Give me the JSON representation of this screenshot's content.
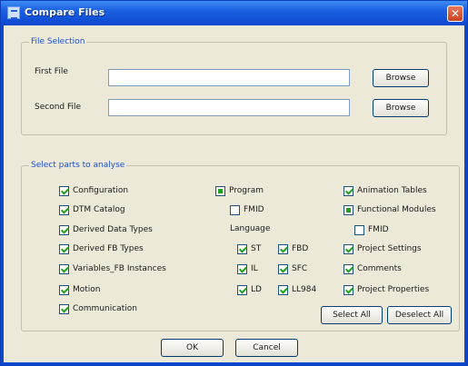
{
  "window": {
    "title": "Compare Files",
    "close_glyph": "✕"
  },
  "file_selection": {
    "legend": "File Selection",
    "first_label": "First File",
    "first_value": "",
    "second_label": "Second File",
    "second_value": "",
    "browse_label": "Browse"
  },
  "parts": {
    "legend": "Select parts to analyse",
    "col1": [
      {
        "label": "Configuration",
        "state": "checked"
      },
      {
        "label": "DTM Catalog",
        "state": "checked"
      },
      {
        "label": "Derived Data Types",
        "state": "checked"
      },
      {
        "label": "Derived FB Types",
        "state": "checked"
      },
      {
        "label": "Variables_FB Instances",
        "state": "checked"
      },
      {
        "label": "Motion",
        "state": "checked"
      },
      {
        "label": "Communication",
        "state": "checked"
      }
    ],
    "program": {
      "label": "Program",
      "state": "partial"
    },
    "program_fmid": {
      "label": "FMID",
      "state": "unchecked"
    },
    "language_label": "Language",
    "languages": [
      {
        "label": "ST",
        "state": "checked"
      },
      {
        "label": "FBD",
        "state": "checked"
      },
      {
        "label": "IL",
        "state": "checked"
      },
      {
        "label": "SFC",
        "state": "checked"
      },
      {
        "label": "LD",
        "state": "checked"
      },
      {
        "label": "LL984",
        "state": "checked"
      }
    ],
    "col3": [
      {
        "label": "Animation Tables",
        "state": "checked"
      },
      {
        "label": "Functional Modules",
        "state": "partial"
      }
    ],
    "fm_fmid": {
      "label": "FMID",
      "state": "unchecked"
    },
    "col3b": [
      {
        "label": "Project Settings",
        "state": "checked"
      },
      {
        "label": "Comments",
        "state": "checked"
      },
      {
        "label": "Project Properties",
        "state": "checked"
      }
    ],
    "select_all": "Select All",
    "deselect_all": "Deselect All"
  },
  "footer": {
    "ok": "OK",
    "cancel": "Cancel"
  },
  "colors": {
    "titlebar": "#0c47cf",
    "dialog_bg": "#ece9d8",
    "legend_text": "#1f4fd0",
    "check": "#21a121"
  }
}
